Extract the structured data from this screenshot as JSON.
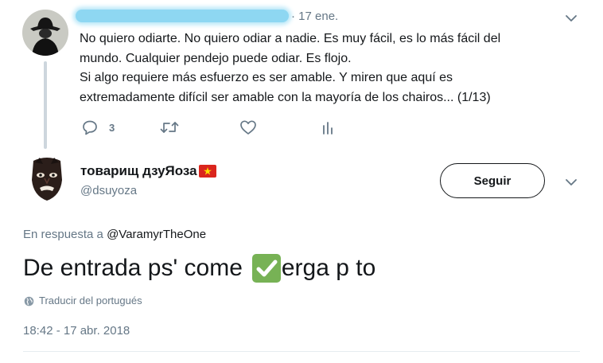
{
  "parent_tweet": {
    "date": "· 17 ene.",
    "text_lines": [
      "No quiero odiarte. No quiero odiar a nadie. Es muy fácil, es lo más fácil del",
      "mundo. Cualquier pendejo puede odiar. Es flojo.",
      "Si algo requiere más esfuerzo es ser amable. Y miren que aquí es",
      "extremadamente difícil ser amable con la mayoría de los chairos... (1/13)"
    ],
    "reply_count": "3",
    "icons": [
      "reply-icon",
      "retweet-icon",
      "like-icon",
      "analytics-icon",
      "chevron-down-icon"
    ]
  },
  "main_tweet": {
    "display_name": "товарищ дзуЯоза",
    "handle": "@dsuyoza",
    "follow_label": "Seguir",
    "reply_prefix": "En respuesta a",
    "reply_mention": "@VaramyrTheOne",
    "text_before": "De entrada ps' come",
    "text_after": "erga p to",
    "translate_label": "Traducir del portugués",
    "timestamp": "18:42 - 17 abr. 2018",
    "icons": [
      "vietnam-flag-icon",
      "check-mark-emoji-icon",
      "globe-icon",
      "chevron-down-icon"
    ]
  },
  "colors": {
    "text": "#14171a",
    "secondary": "#657786",
    "thread_line": "#cdd6dd",
    "redaction": "#8ed7f2",
    "check_emoji": "#77b255"
  }
}
